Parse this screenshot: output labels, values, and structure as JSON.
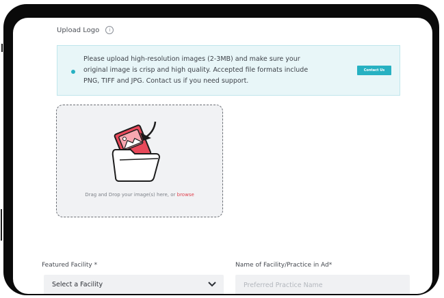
{
  "upload": {
    "label": "Upload Logo",
    "info_icon": "info-icon"
  },
  "notice": {
    "line1": "Please upload high-resolution images (2-3MB) and make sure your",
    "line2": "original image is crisp and high quality. Accepted file formats include",
    "line3": "PNG, TIFF and JPG. Contact us if you need support.",
    "contact_label": "Contact Us",
    "accent_color": "#27b1c2"
  },
  "dropzone": {
    "text": "Drag and Drop your image(s) here, or",
    "browse": "browse",
    "illustration": "folder-image-icon"
  },
  "form": {
    "facility_label": "Featured Facility *",
    "facility_value": "Select a Facility",
    "name_label": "Name of Facility/Practice in Ad*",
    "name_placeholder": "Preferred Practice Name"
  },
  "colors": {
    "bezel": "#0a0a0a",
    "browse_link": "#e0424e",
    "illustration_red": "#e8495a"
  }
}
